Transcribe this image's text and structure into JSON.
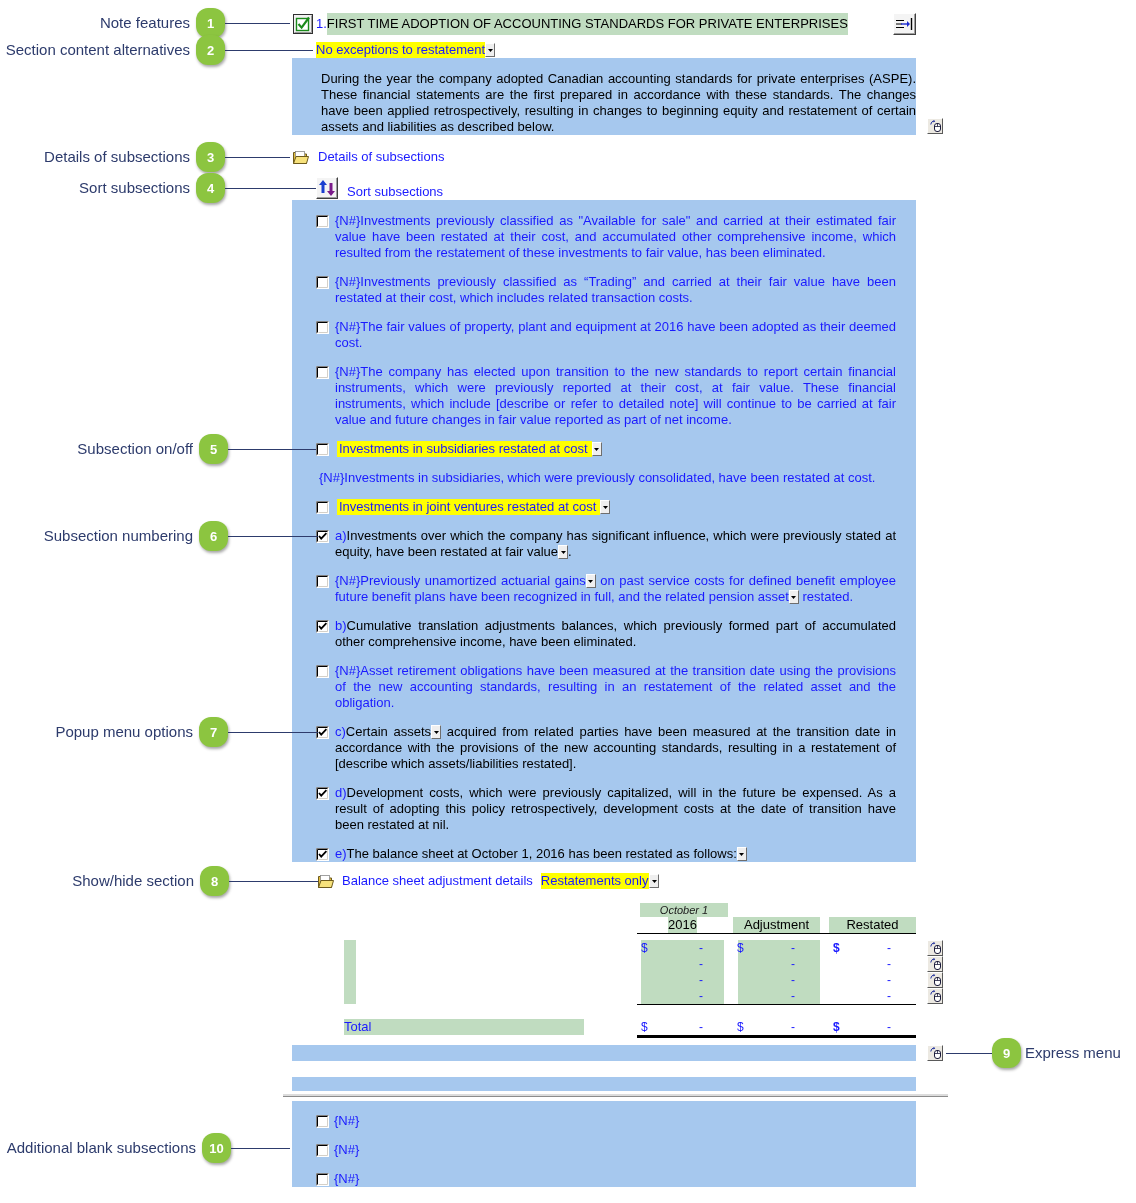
{
  "note_header": {
    "checked": true,
    "number": "1.",
    "title": "FIRST TIME ADOPTION OF ACCOUNTING STANDARDS FOR PRIVATE ENTERPRISES",
    "callout": {
      "number": "1",
      "label": "Note features"
    }
  },
  "content_alternative": {
    "value": "No exceptions to restatement",
    "callout": {
      "number": "2",
      "label": "Section content alternatives"
    }
  },
  "intro": "During the year the company adopted Canadian accounting standards for private enterprises (ASPE). These financial statements are the first prepared in accordance with these standards. The changes have been applied retrospectively, resulting in changes to beginning equity and restatement of certain assets and liabilities as described below.",
  "details_link": {
    "label": "Details of subsections",
    "callout": {
      "number": "3",
      "label": "Details of subsections"
    }
  },
  "sort_link": {
    "label": "Sort subsections",
    "callout": {
      "number": "4",
      "label": "Sort subsections"
    }
  },
  "subsections": [
    {
      "kind": "paragraph",
      "checked": false,
      "number": "{N#}",
      "segments": [
        {
          "kind": "text",
          "text": "Investments previously classified as \"Available for sale\" and carried at their estimated fair value have been restated at their cost, and accumulated other comprehensive income, which resulted from the restatement of these investments to fair value, has been eliminated."
        }
      ]
    },
    {
      "kind": "paragraph",
      "checked": false,
      "number": "{N#}",
      "segments": [
        {
          "kind": "text",
          "text": "Investments previously classified as “Trading” and carried at their fair value have been restated at their cost, which includes related transaction costs."
        }
      ]
    },
    {
      "kind": "paragraph",
      "checked": false,
      "number": "{N#}",
      "segments": [
        {
          "kind": "text",
          "text": "The fair values of property, plant and equipment at 2016 have been adopted as their deemed cost."
        }
      ]
    },
    {
      "kind": "paragraph",
      "checked": false,
      "number": "{N#}",
      "segments": [
        {
          "kind": "text",
          "text": "The company has elected upon transition to the new standards to report certain financial instruments, which were previously reported at their cost, at fair value. These financial instruments, which include [describe or refer to detailed note] will continue to be carried at fair value and future changes in fair value reported as part of net income."
        }
      ]
    },
    {
      "kind": "toggle",
      "checked": false,
      "label": "Investments in subsidiaries restated at cost",
      "body": {
        "number": "{N#}",
        "text": "Investments in subsidiaries, which were previously consolidated, have been restated at cost."
      },
      "callout": {
        "number": "5",
        "label": "Subsection on/off"
      }
    },
    {
      "kind": "toggle",
      "checked": false,
      "label": "Investments in joint ventures restated at cost"
    },
    {
      "kind": "paragraph",
      "checked": true,
      "number": "a)",
      "segments": [
        {
          "kind": "text",
          "text": "Investments over which the company has significant influence, which were previously stated at equity, have been restated at fair value"
        },
        {
          "kind": "dropdown"
        },
        {
          "kind": "text",
          "text": "."
        }
      ],
      "callout": {
        "number": "6",
        "label": "Subsection numbering"
      }
    },
    {
      "kind": "paragraph",
      "checked": false,
      "number": "{N#}",
      "segments": [
        {
          "kind": "text",
          "text": "Previously unamortized actuarial gains"
        },
        {
          "kind": "dropdown"
        },
        {
          "kind": "text",
          "text": " on past service costs for defined benefit employee future benefit plans have been recognized in full, and the related pension asset"
        },
        {
          "kind": "dropdown"
        },
        {
          "kind": "text",
          "text": " restated."
        }
      ]
    },
    {
      "kind": "paragraph",
      "checked": true,
      "number": "b)",
      "segments": [
        {
          "kind": "text",
          "text": "Cumulative translation adjustments balances, which previously formed part of accumulated other comprehensive income, have been eliminated."
        }
      ]
    },
    {
      "kind": "paragraph",
      "checked": false,
      "number": "{N#}",
      "segments": [
        {
          "kind": "text",
          "text": "Asset retirement obligations have been measured at the transition date using the provisions of the new accounting standards, resulting in an restatement of the related asset and the obligation."
        }
      ]
    },
    {
      "kind": "paragraph",
      "checked": true,
      "number": "c)",
      "segments": [
        {
          "kind": "text",
          "text": "Certain assets"
        },
        {
          "kind": "dropdown"
        },
        {
          "kind": "text",
          "text": " acquired from related parties have been measured at the transition date in accordance with the provisions of the new accounting standards, resulting in a restatement of [describe which assets/liabilities restated]."
        }
      ],
      "callout": {
        "number": "7",
        "label": "Popup menu options"
      }
    },
    {
      "kind": "paragraph",
      "checked": true,
      "number": "d)",
      "segments": [
        {
          "kind": "text",
          "text": "Development costs, which were previously capitalized, will in the future be expensed. As a result of adopting this policy retrospectively, development costs at the date of transition have been restated at nil."
        }
      ]
    },
    {
      "kind": "paragraph",
      "checked": true,
      "number": "e)",
      "segments": [
        {
          "kind": "text",
          "text": "The balance sheet at October 1, 2016 has been restated as follows:"
        },
        {
          "kind": "dropdown"
        }
      ]
    }
  ],
  "balance_sheet_details": {
    "label": "Balance sheet adjustment details",
    "option": "Restatements only",
    "callout": {
      "number": "8",
      "label": "Show/hide section"
    }
  },
  "table": {
    "columns": [
      {
        "kind": "input",
        "caption": "October 1",
        "heading": "2016"
      },
      {
        "kind": "input",
        "heading": "Adjustment"
      },
      {
        "kind": "computed",
        "heading": "Restated"
      }
    ],
    "rows": [
      {
        "cells": [
          {
            "symbol": "$",
            "value": "-"
          },
          {
            "symbol": "$",
            "value": "-"
          },
          {
            "symbol": "$",
            "value": "-"
          }
        ]
      },
      {
        "cells": [
          {
            "value": "-"
          },
          {
            "value": "-"
          },
          {
            "value": "-"
          }
        ]
      },
      {
        "cells": [
          {
            "value": "-"
          },
          {
            "value": "-"
          },
          {
            "value": "-"
          }
        ]
      },
      {
        "cells": [
          {
            "value": "-"
          },
          {
            "value": "-"
          },
          {
            "value": "-"
          }
        ]
      }
    ],
    "total": {
      "label": "Total",
      "cells": [
        {
          "symbol": "$",
          "value": "-"
        },
        {
          "symbol": "$",
          "value": "-"
        },
        {
          "symbol": "$",
          "value": "-"
        }
      ]
    }
  },
  "express_menu": {
    "callout": {
      "number": "9",
      "label": "Express menu"
    }
  },
  "blank_subsections": {
    "callout": {
      "number": "10",
      "label": "Additional blank subsections"
    },
    "items": [
      {
        "checked": false,
        "number": "{N#}"
      },
      {
        "checked": false,
        "number": "{N#}"
      },
      {
        "checked": false,
        "number": "{N#}"
      }
    ]
  }
}
